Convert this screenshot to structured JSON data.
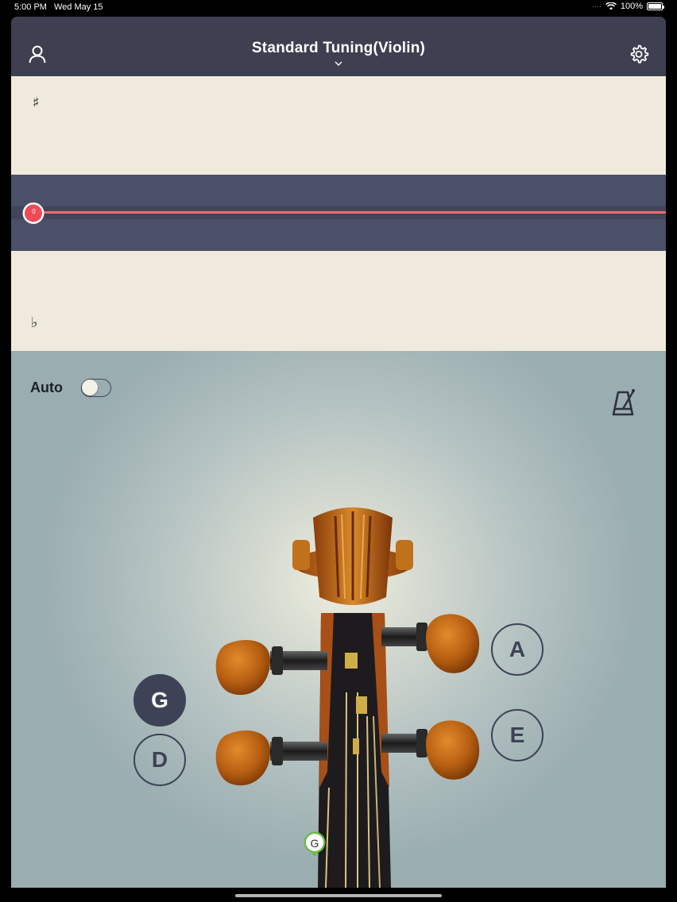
{
  "status": {
    "time": "5:00 PM",
    "date": "Wed May 15",
    "battery": "100%"
  },
  "header": {
    "title": "Standard Tuning(Violin)",
    "user_icon": "user-icon",
    "settings_icon": "gear-icon",
    "dropdown_icon": "chevron-down-icon"
  },
  "meter": {
    "sharp_symbol": "♯",
    "flat_symbol": "♭",
    "needle_value": "0",
    "accent": "#f06a6e",
    "band_color": "#4b4f68"
  },
  "controls": {
    "auto_label": "Auto",
    "auto_enabled": false,
    "metronome_icon": "metronome-icon"
  },
  "strings": {
    "left": [
      {
        "label": "G",
        "active": true
      },
      {
        "label": "D",
        "active": false
      }
    ],
    "right": [
      {
        "label": "A",
        "active": false
      },
      {
        "label": "E",
        "active": false
      }
    ]
  },
  "pin": {
    "label": "G"
  }
}
